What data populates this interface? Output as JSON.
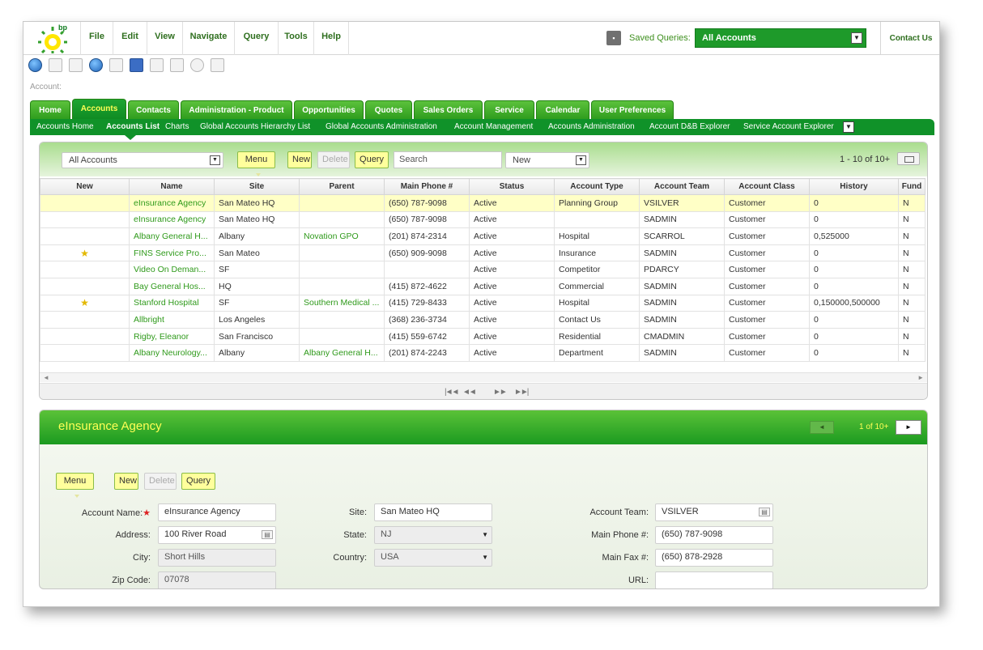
{
  "menubar": {
    "items": [
      "File",
      "Edit",
      "View",
      "Navigate",
      "Query",
      "Tools",
      "Help"
    ],
    "logo_text": "bp",
    "saved_queries_label": "Saved Queries:",
    "saved_queries_value": "All Accounts",
    "contact_us": "Contact Us"
  },
  "breadcrumb": "Account:",
  "tabs": [
    "Home",
    "Accounts",
    "Contacts",
    "Administration - Product",
    "Opportunities",
    "Quotes",
    "Sales Orders",
    "Service",
    "Calendar",
    "User Preferences"
  ],
  "active_tab": "Accounts",
  "subnav": [
    "Accounts Home",
    "Accounts List",
    "Charts",
    "Global Accounts Hierarchy List",
    "Global Accounts Administration",
    "Account Management",
    "Accounts Administration",
    "Account D&B Explorer",
    "Service Account Explorer"
  ],
  "active_subnav": "Accounts List",
  "list": {
    "query_select": "All Accounts",
    "menu_label": "Menu",
    "new_label": "New",
    "delete_label": "Delete",
    "query_label": "Query",
    "search_placeholder": "Search",
    "new_select": "New",
    "record_count": "1 - 10 of 10+",
    "columns": [
      "New",
      "Name",
      "Site",
      "Parent",
      "Main Phone #",
      "Status",
      "Account Type",
      "Account Team",
      "Account Class",
      "History",
      "Fund"
    ],
    "rows": [
      [
        "",
        "eInsurance Agency",
        "San Mateo HQ",
        "",
        "(650) 787-9098",
        "Active",
        "Planning Group",
        "VSILVER",
        "Customer",
        "0",
        "N"
      ],
      [
        "",
        "eInsurance Agency",
        "San Mateo HQ",
        "",
        "(650) 787-9098",
        "Active",
        "",
        "SADMIN",
        "Customer",
        "0",
        "N"
      ],
      [
        "",
        "Albany General H...",
        "Albany",
        "Novation GPO",
        "(201) 874-2314",
        "Active",
        "Hospital",
        "SCARROL",
        "Customer",
        "0,525000",
        "N"
      ],
      [
        "★",
        "FINS Service Pro...",
        "San Mateo",
        "",
        "(650) 909-9098",
        "Active",
        "Insurance",
        "SADMIN",
        "Customer",
        "0",
        "N"
      ],
      [
        "",
        "Video On Deman...",
        "SF",
        "",
        "",
        "Active",
        "Competitor",
        "PDARCY",
        "Customer",
        "0",
        "N"
      ],
      [
        "",
        "Bay General Hos...",
        "HQ",
        "",
        "(415) 872-4622",
        "Active",
        "Commercial",
        "SADMIN",
        "Customer",
        "0",
        "N"
      ],
      [
        "★",
        "Stanford Hospital",
        "SF",
        "Southern Medical ...",
        "(415) 729-8433",
        "Active",
        "Hospital",
        "SADMIN",
        "Customer",
        "0,150000,500000",
        "N"
      ],
      [
        "",
        "Allbright",
        "Los Angeles",
        "",
        "(368) 236-3734",
        "Active",
        "Contact Us",
        "SADMIN",
        "Customer",
        "0",
        "N"
      ],
      [
        "",
        "Rigby, Eleanor",
        "San Francisco",
        "",
        "(415) 559-6742",
        "Active",
        "Residential",
        "CMADMIN",
        "Customer",
        "0",
        "N"
      ],
      [
        "",
        "Albany Neurology...",
        "Albany",
        "Albany General H...",
        "(201) 874-2243",
        "Active",
        "Department",
        "SADMIN",
        "Customer",
        "0",
        "N"
      ]
    ]
  },
  "form": {
    "title": "eInsurance Agency",
    "record_count": "1 of 10+",
    "menu_label": "Menu",
    "new_label": "New",
    "delete_label": "Delete",
    "query_label": "Query",
    "account_name_label": "Account Name:",
    "account_name": "eInsurance Agency",
    "address_label": "Address:",
    "address": "100 River Road",
    "city_label": "City:",
    "city": "Short Hills",
    "zip_label": "Zip Code:",
    "zip": "07078",
    "site_label": "Site:",
    "site": "San Mateo HQ",
    "state_label": "State:",
    "state": "NJ",
    "country_label": "Country:",
    "country": "USA",
    "team_label": "Account Team:",
    "team": "VSILVER",
    "phone_label": "Main Phone #:",
    "phone": "(650) 787-9098",
    "fax_label": "Main Fax #:",
    "fax": "(650) 878-2928",
    "url_label": "URL:",
    "url": ""
  },
  "colors": {
    "brand_green": "#109229",
    "highlight_yellow": "#ffff55",
    "selected_row": "#ffffc6"
  }
}
